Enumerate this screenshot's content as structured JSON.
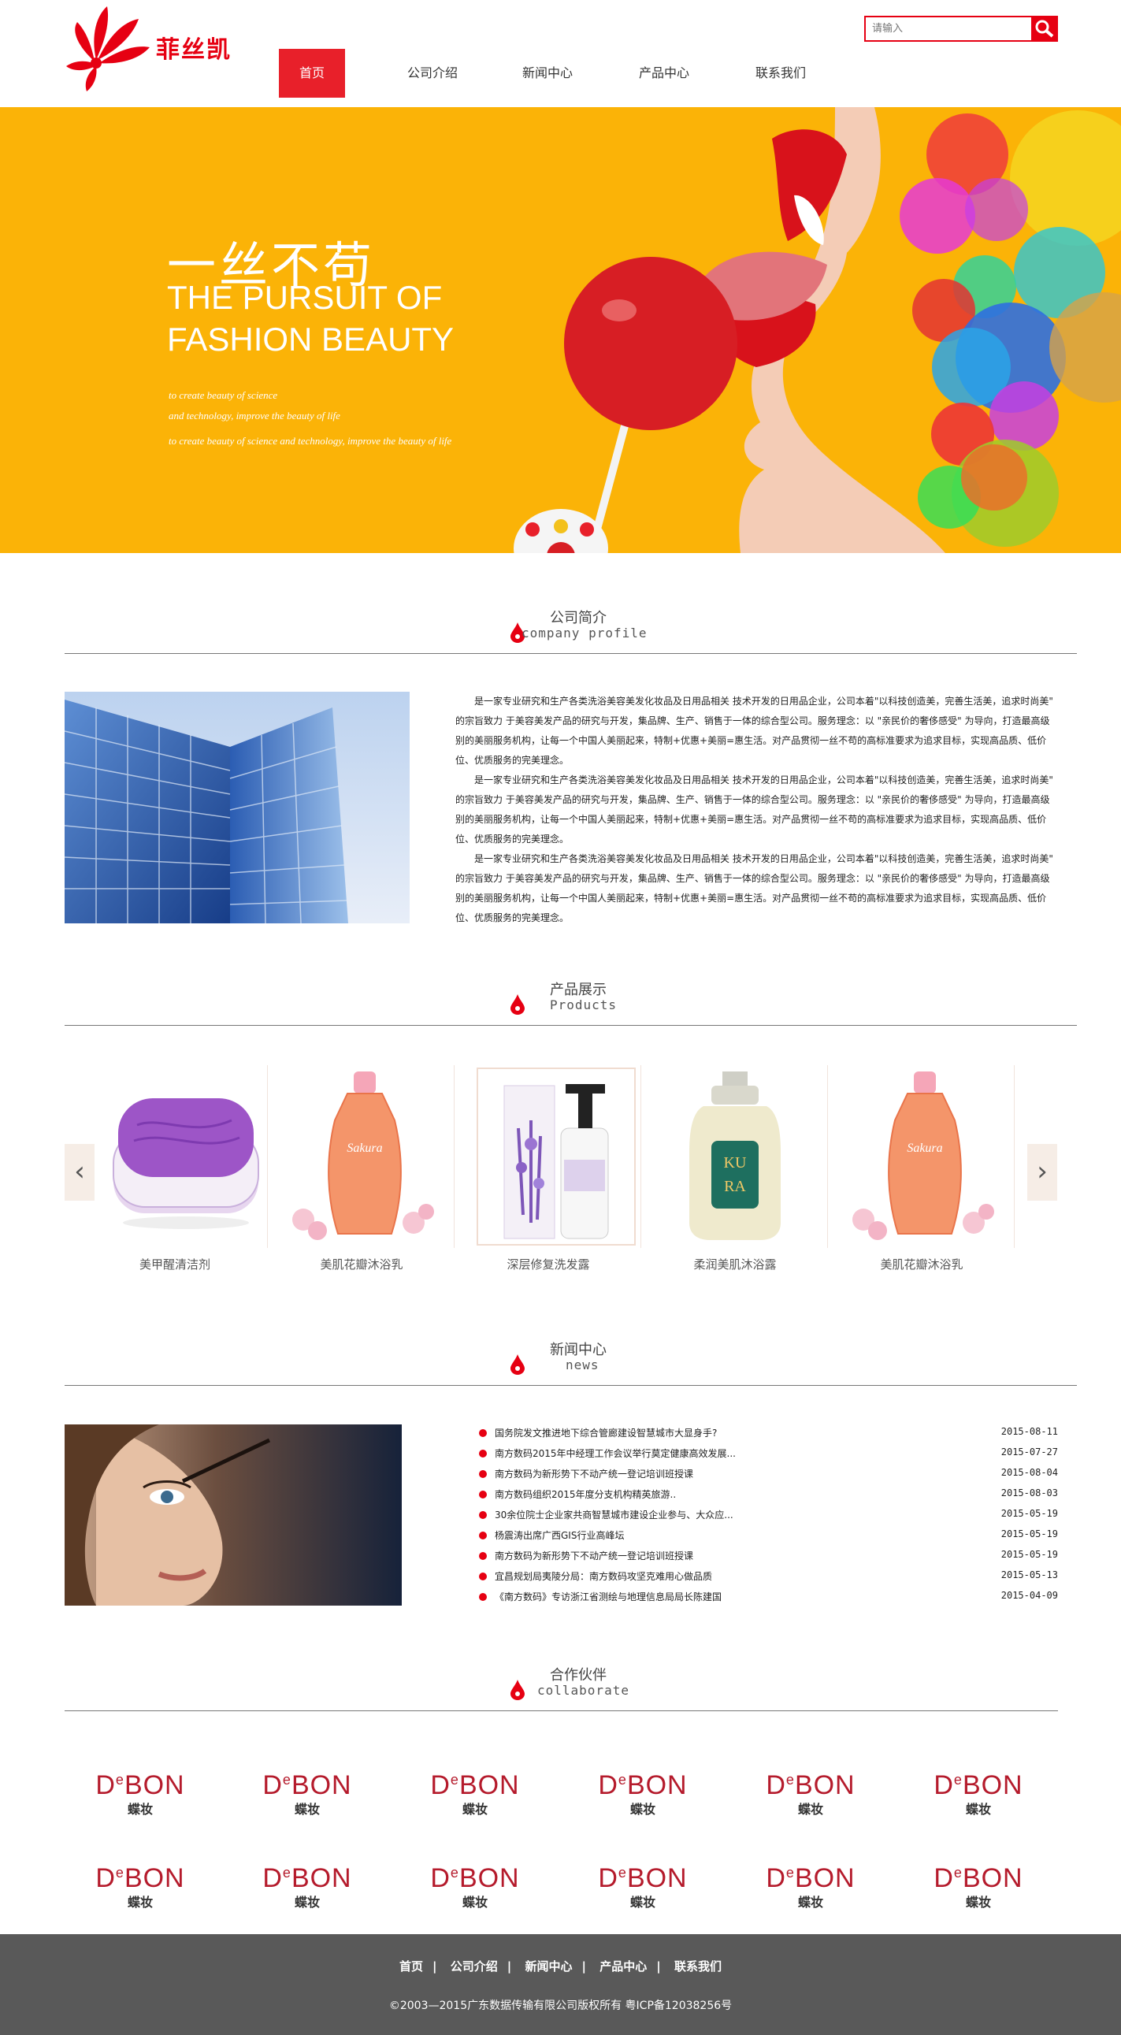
{
  "site": {
    "brand_name": "菲丝凯"
  },
  "search": {
    "placeholder": "请输入"
  },
  "nav": {
    "items": [
      "首页",
      "公司介绍",
      "新闻中心",
      "产品中心",
      "联系我们"
    ],
    "active": 0
  },
  "banner": {
    "title_cn": "一丝不苟",
    "title_en_line1": "THE PURSUIT OF",
    "title_en_line2": "FASHION BEAUTY",
    "line1": "to create beauty of science",
    "line2": "and technology, improve the beauty of life",
    "line3": "to create beauty of science and technology, improve the beauty of life"
  },
  "profile": {
    "title_cn": "公司简介",
    "title_en": "company profile",
    "paragraphs": [
      "是一家专业研究和生产各类洗浴美容美发化妆品及日用品相关 技术开发的日用品企业，公司本着\"以科技创造美，完善生活美，追求时尚美\" 的宗旨致力 于美容美发产品的研究与开发，集品牌、生产、销售于一体的综合型公司。服务理念：以 \"亲民价的奢侈感受\" 为导向，打造最高级别的美丽服务机构，让每一个中国人美丽起来，特制+优惠+美丽=惠生活。对产品贯彻一丝不苟的高标准要求为追求目标，实现高品质、低价位、优质服务的完美理念。",
      "是一家专业研究和生产各类洗浴美容美发化妆品及日用品相关 技术开发的日用品企业，公司本着\"以科技创造美，完善生活美，追求时尚美\" 的宗旨致力 于美容美发产品的研究与开发，集品牌、生产、销售于一体的综合型公司。服务理念：以 \"亲民价的奢侈感受\" 为导向，打造最高级别的美丽服务机构，让每一个中国人美丽起来，特制+优惠+美丽=惠生活。对产品贯彻一丝不苟的高标准要求为追求目标，实现高品质、低价位、优质服务的完美理念。",
      "是一家专业研究和生产各类洗浴美容美发化妆品及日用品相关 技术开发的日用品企业，公司本着\"以科技创造美，完善生活美，追求时尚美\" 的宗旨致力 于美容美发产品的研究与开发，集品牌、生产、销售于一体的综合型公司。服务理念：以 \"亲民价的奢侈感受\" 为导向，打造最高级别的美丽服务机构，让每一个中国人美丽起来，特制+优惠+美丽=惠生活。对产品贯彻一丝不苟的高标准要求为追求目标，实现高品质、低价位、优质服务的完美理念。"
    ]
  },
  "products": {
    "title_cn": "产品展示",
    "title_en": "Products",
    "prev": "‹",
    "next": "›",
    "items": [
      {
        "name": "美甲醒清洁剂",
        "kind": "jar"
      },
      {
        "name": "美肌花瓣沐浴乳",
        "kind": "orange-bottle"
      },
      {
        "name": "深层修复洗发露",
        "kind": "lavender"
      },
      {
        "name": "柔润美肌沐浴露",
        "kind": "pump"
      },
      {
        "name": "美肌花瓣沐浴乳",
        "kind": "orange-bottle"
      }
    ]
  },
  "news": {
    "title_cn": "新闻中心",
    "title_en": "news",
    "items": [
      {
        "title": "国务院发文推进地下综合管廊建设智慧城市大显身手?",
        "date": "2015-08-11"
      },
      {
        "title": "南方数码2015年中经理工作会议举行莫定健康高效发展...",
        "date": "2015-07-27"
      },
      {
        "title": "南方数码为新形势下不动产统一登记培训班授课",
        "date": "2015-08-04"
      },
      {
        "title": "南方数码组织2015年度分支机构精英旅游..",
        "date": "2015-08-03"
      },
      {
        "title": "30余位院士企业家共商智慧城市建设企业参与、大众应...",
        "date": "2015-05-19"
      },
      {
        "title": "杨震涛出席广西GIS行业高峰坛",
        "date": "2015-05-19"
      },
      {
        "title": "南方数码为新形势下不动产统一登记培训班授课",
        "date": "2015-05-19"
      },
      {
        "title": "宜昌规划局夷陵分局：南方数码攻坚克难用心做品质",
        "date": "2015-05-13"
      },
      {
        "title": "《南方数码》专访浙江省测绘与地理信息局局长陈建国",
        "date": "2015-04-09"
      }
    ]
  },
  "partners": {
    "title_cn": "合作伙伴",
    "title_en": "collaborate",
    "logo_text_main": "BON",
    "logo_text_d": "D",
    "logo_text_e": "e",
    "logo_sub": "蝶妆",
    "count": 12
  },
  "footer": {
    "links": [
      "首页",
      "公司介绍",
      "新闻中心",
      "产品中心",
      "联系我们"
    ],
    "separator": "|",
    "copyright": "©2003—2015广东数据传输有限公司版权所有  粤ICP备12038256号"
  },
  "colors": {
    "accent": "#e60012",
    "banner_bg": "#fbb307",
    "footer_bg": "#595959"
  }
}
